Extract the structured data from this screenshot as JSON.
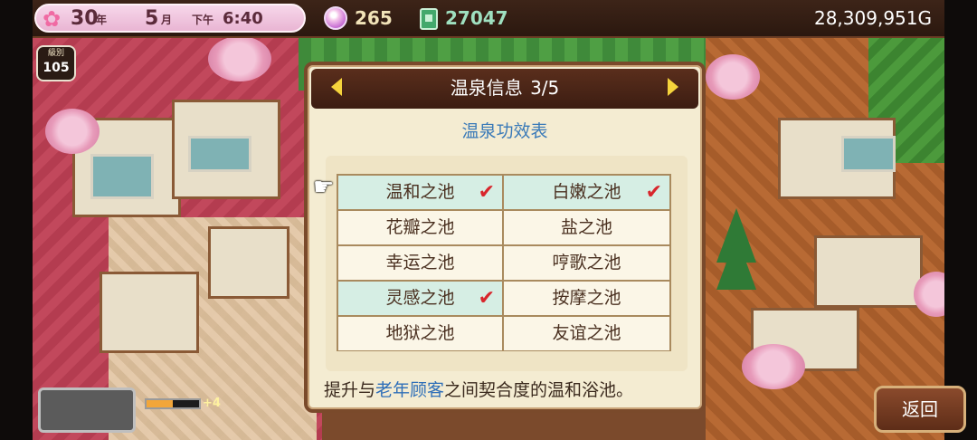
{
  "hud": {
    "year_num": "30",
    "year_unit": "年",
    "month_num": "5",
    "month_unit": "月",
    "ampm": "下午",
    "time": "6:40",
    "gems": "265",
    "tickets": "27047",
    "gold": "28,309,951G"
  },
  "rank": {
    "label": "級別",
    "value": "105"
  },
  "progress": {
    "fraction": 0.5,
    "bonus": "+4"
  },
  "dialog": {
    "title": "温泉信息",
    "page": "3/5",
    "subtitle": "温泉功效表",
    "cells": [
      {
        "label": "温和之池",
        "checked": true
      },
      {
        "label": "白嫩之池",
        "checked": true
      },
      {
        "label": "花瓣之池",
        "checked": false
      },
      {
        "label": "盐之池",
        "checked": false
      },
      {
        "label": "幸运之池",
        "checked": false
      },
      {
        "label": "哼歌之池",
        "checked": false
      },
      {
        "label": "灵感之池",
        "checked": true
      },
      {
        "label": "按摩之池",
        "checked": false
      },
      {
        "label": "地狱之池",
        "checked": false
      },
      {
        "label": "友谊之池",
        "checked": false
      }
    ],
    "check_mark": "✔",
    "description_pre": "提升与",
    "description_highlight": "老年顾客",
    "description_post": "之间契合度的温和浴池。"
  },
  "back_button": "返回",
  "colors": {
    "accent": "#f5d43c",
    "highlight": "#2f6fb8",
    "check": "#d8262c"
  },
  "icons": {
    "pointer": "hand-pointer-icon",
    "gem": "gem-icon",
    "ticket": "ticket-icon",
    "sakura": "sakura-icon"
  }
}
